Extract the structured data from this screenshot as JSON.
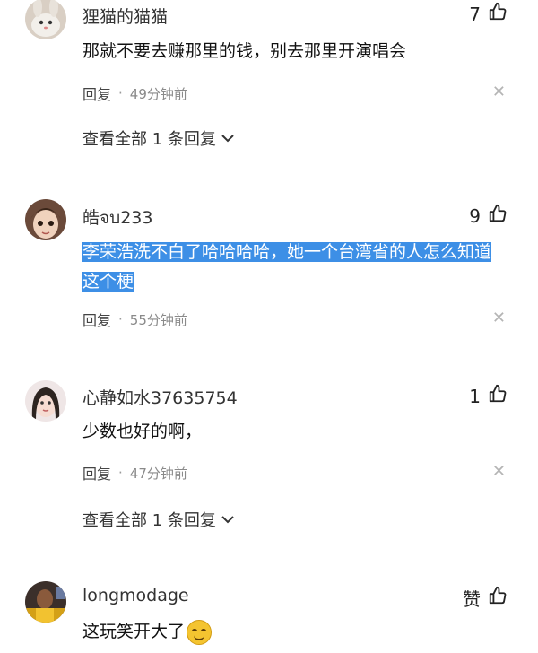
{
  "comments": [
    {
      "username": "狸猫的猫猫",
      "likes": "7",
      "content": "那就不要去赚那里的钱，别去那里开演唱会",
      "reply_label": "回复",
      "time": "49分钟前",
      "view_all": "查看全部 1 条回复"
    },
    {
      "username": "皓จบ233",
      "likes": "9",
      "content": "李荣浩洗不白了哈哈哈哈，她一个台湾省的人怎么知道这个梗",
      "reply_label": "回复",
      "time": "55分钟前"
    },
    {
      "username": "心静如水37635754",
      "likes": "1",
      "content": "少数也好的啊，",
      "reply_label": "回复",
      "time": "47分钟前",
      "view_all": "查看全部 1 条回复"
    },
    {
      "username": "longmodage",
      "likes": "赞",
      "content": "这玩笑开大了"
    }
  ],
  "colors": {
    "highlight": "#3d8fe6",
    "meta_gray": "#8a8a8a"
  },
  "icons": [
    "thumbs-up-icon",
    "close-icon",
    "chevron-down-icon",
    "smile-emoji-icon"
  ]
}
